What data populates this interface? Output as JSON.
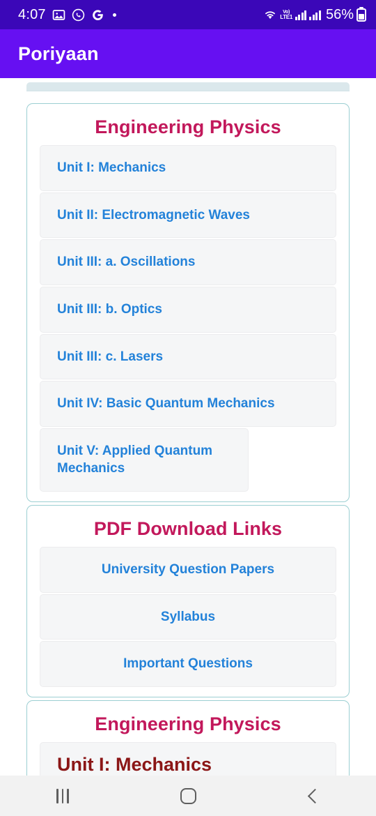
{
  "status_bar": {
    "time": "4:07",
    "icons_left": [
      "gallery-icon",
      "whatsapp-icon",
      "google-icon",
      "dot-icon"
    ],
    "icons_right": [
      "wifi-icon",
      "volte-icon",
      "signal-bars-icon",
      "signal-bars-icon"
    ],
    "volte_line1": "Vo)",
    "volte_line2": "LTE1",
    "battery_percent": "56%",
    "background_color": "#3b07b8"
  },
  "app_bar": {
    "title": "Poriyaan",
    "background_color": "#6610f2",
    "text_color": "#ffffff"
  },
  "theme": {
    "card_border": "#9ccfd2",
    "heading_color": "#c2185b",
    "link_color": "#2382d9",
    "unit_heading_color": "#8b1616",
    "item_background": "#f5f6f7"
  },
  "cards": [
    {
      "title": "Engineering Physics",
      "align": "left",
      "items": [
        "Unit I: Mechanics",
        "Unit II: Electromagnetic Waves",
        "Unit III: a. Oscillations",
        "Unit III: b. Optics",
        "Unit III: c. Lasers",
        "Unit IV: Basic Quantum Mechanics",
        "Unit V: Applied Quantum Mechanics"
      ]
    },
    {
      "title": "PDF Download Links",
      "align": "center",
      "items": [
        "University Question Papers",
        "Syllabus",
        "Important Questions"
      ]
    },
    {
      "title": "Engineering Physics",
      "align": "left",
      "unit_heading": "Unit I: Mechanics"
    }
  ],
  "nav_bar": {
    "recents_label": "recents-icon",
    "home_label": "home-icon",
    "back_label": "back-icon"
  }
}
